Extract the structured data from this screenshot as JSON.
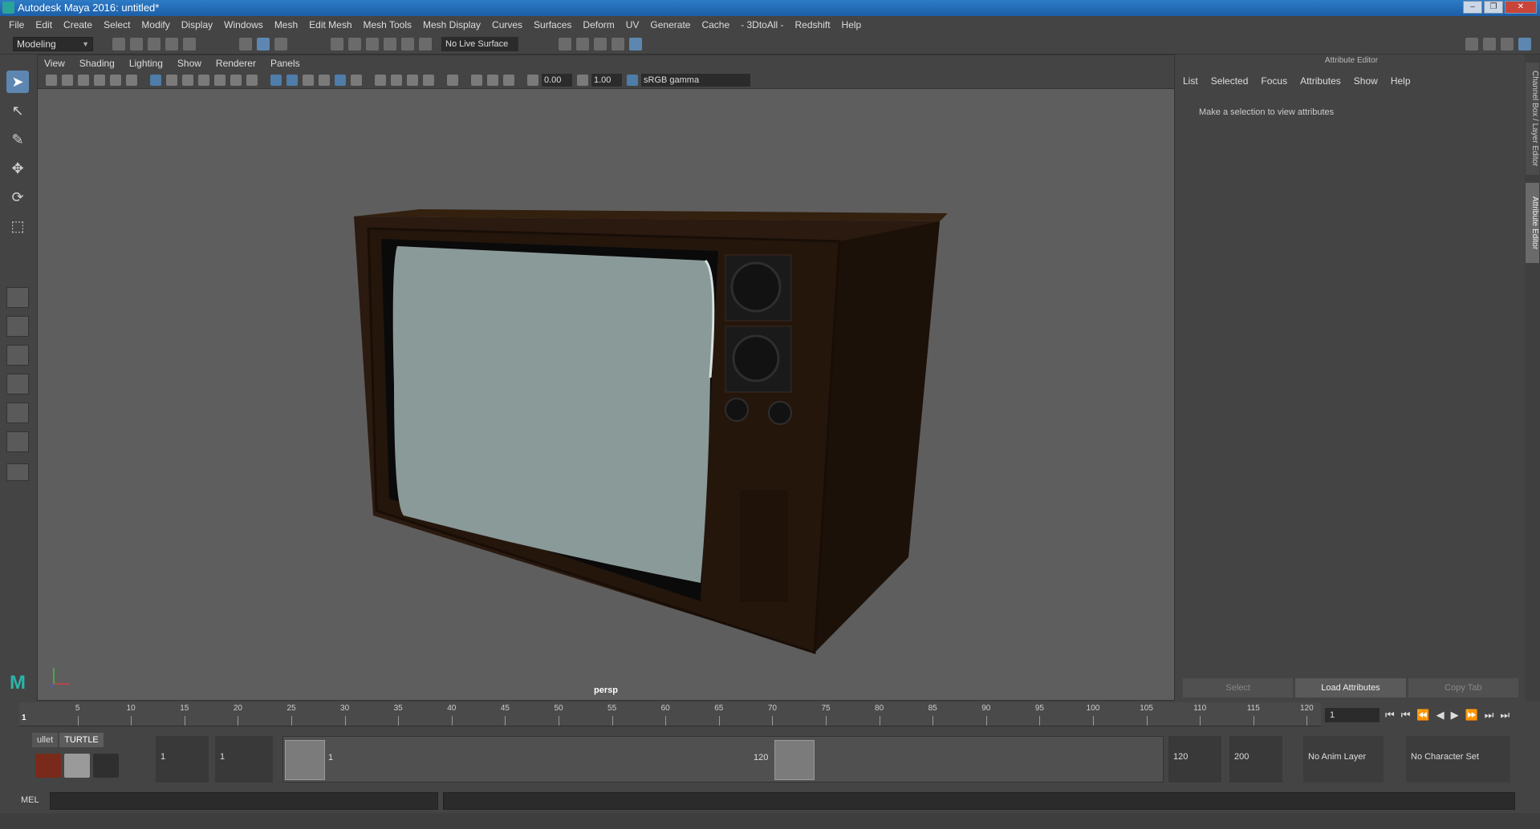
{
  "window": {
    "title": "Autodesk Maya 2016: untitled*",
    "controls": [
      "–",
      "❐",
      "✕"
    ]
  },
  "menubar": {
    "items": [
      "File",
      "Edit",
      "Create",
      "Select",
      "Modify",
      "Display",
      "Windows",
      "Mesh",
      "Edit Mesh",
      "Mesh Tools",
      "Mesh Display",
      "Curves",
      "Surfaces",
      "Deform",
      "UV",
      "Generate",
      "Cache",
      "- 3DtoAll -",
      "Redshift",
      "Help"
    ]
  },
  "shelfbar": {
    "mode": "Modeling",
    "live_surface": "No Live Surface"
  },
  "viewport": {
    "menu": [
      "View",
      "Shading",
      "Lighting",
      "Show",
      "Renderer",
      "Panels"
    ],
    "exposure": "0.00",
    "gamma": "1.00",
    "color_space": "sRGB gamma",
    "camera": "persp"
  },
  "attribute_editor": {
    "title": "Attribute Editor",
    "menu": [
      "List",
      "Selected",
      "Focus",
      "Attributes",
      "Show",
      "Help"
    ],
    "message": "Make a selection to view attributes",
    "buttons": [
      "Select",
      "Load Attributes",
      "Copy Tab"
    ]
  },
  "side_tabs": {
    "channel_box": "Channel Box / Layer Editor",
    "attribute_editor": "Attribute Editor"
  },
  "timeline": {
    "ticks": [
      "5",
      "10",
      "15",
      "20",
      "25",
      "30",
      "35",
      "40",
      "45",
      "50",
      "55",
      "60",
      "65",
      "70",
      "75",
      "80",
      "85",
      "90",
      "95",
      "100",
      "105",
      "110",
      "115",
      "120"
    ],
    "current_frame_marker": "1",
    "current_frame": "1",
    "playback_icons": [
      "⏮",
      "⏮",
      "⏪",
      "◀",
      "▶",
      "⏩",
      "⏭",
      "⏭"
    ]
  },
  "range": {
    "shelf_tabs": [
      "ullet",
      "TURTLE"
    ],
    "start_field": "1",
    "playback_start_field": "1",
    "range_start_label": "1",
    "range_end_label": "120",
    "playback_end_field": "120",
    "end_field": "200",
    "anim_layer": "No Anim Layer",
    "character_set": "No Character Set"
  },
  "cmdline": {
    "label": "MEL"
  },
  "colors": {
    "accent": "#5d87b0",
    "tv_body": "#2a1a10",
    "screen": "#8a9a98"
  }
}
